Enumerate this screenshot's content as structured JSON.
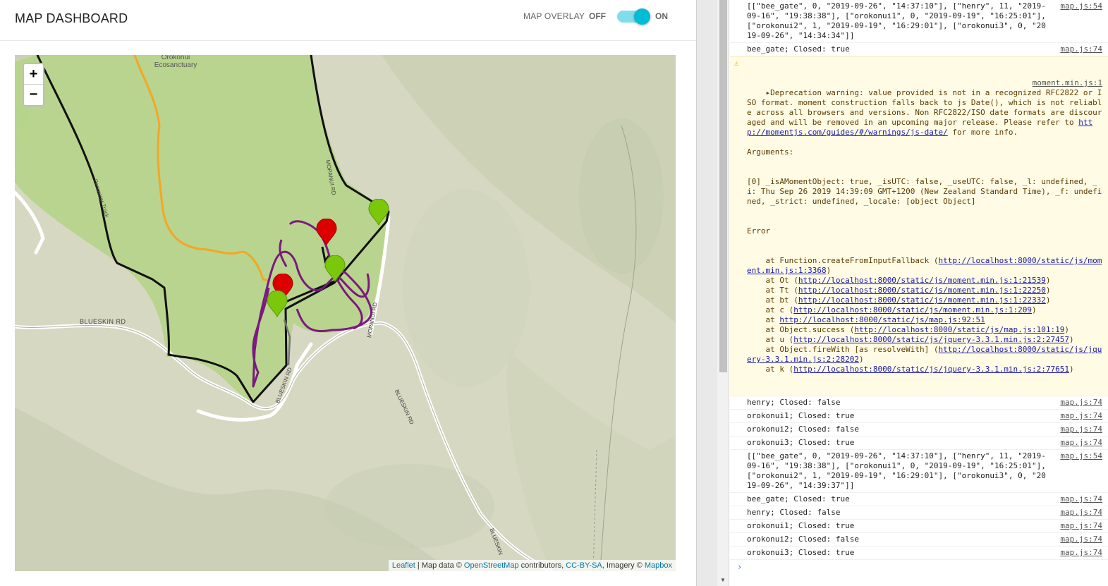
{
  "header": {
    "title": "MAP DASHBOARD",
    "overlay_label": "MAP OVERLAY",
    "off_label": "OFF",
    "on_label": "ON",
    "overlay_enabled": true
  },
  "map": {
    "zoom_in": "+",
    "zoom_out": "−",
    "labels": {
      "ecosanctuary": "Orokonui Ecosanctuary",
      "blueskin_rd": "BLUESKIN RD",
      "mopanui_rd": "MOPANUI RD",
      "perimeter_track": "Perimeter Track",
      "blueskin_short": "BLUESKIN"
    },
    "attribution": {
      "leaflet": "Leaflet",
      "map_data": " | Map data © ",
      "osm": "OpenStreetMap",
      "contributors": " contributors, ",
      "ccbysa": "CC-BY-SA",
      "imagery": ", Imagery © ",
      "mapbox": "Mapbox"
    },
    "colors": {
      "sanctuary_fill": "#b5d48a",
      "boundary": "#111111",
      "trail_orange": "#f5a623",
      "trail_purple": "#7b1a7e",
      "marker_open": "#7ac70c",
      "marker_closed": "#dd0000"
    },
    "markers": [
      {
        "name": "green-marker-1",
        "status": "open"
      },
      {
        "name": "red-marker-1",
        "status": "closed"
      },
      {
        "name": "green-marker-2",
        "status": "open"
      },
      {
        "name": "red-marker-2",
        "status": "closed"
      },
      {
        "name": "green-marker-3",
        "status": "open"
      }
    ]
  },
  "console": {
    "lines": [
      {
        "text": "[[\"bee_gate\", 0, \"2019-09-26\", \"14:37:10\"], [\"henry\", 11, \"2019-09-16\", \"19:38:38\"], [\"orokonui1\", 0, \"2019-09-19\", \"16:25:01\"], [\"orokonui2\", 1, \"2019-09-19\", \"16:29:01\"], [\"orokonui3\", 0, \"2019-09-26\", \"14:34:34\"]]",
        "src": "map.js:54"
      },
      {
        "text": "bee_gate; Closed: true",
        "src": "map.js:74"
      }
    ],
    "warning": {
      "src": "moment.min.js:1",
      "intro": "Deprecation warning: value provided is not in a recognized RFC2822 or ISO format. moment construction falls back to js Date(), which is not reliable across all browsers and versions. Non RFC2822/ISO date formats are discouraged and will be removed in an upcoming major release. Please refer to ",
      "link": "http://momentjs.com/guides/#/warnings/js-date/",
      "outro": " for more info.",
      "args_header": "Arguments:",
      "args": "[0] _isAMomentObject: true, _isUTC: false, _useUTC: false, _l: undefined, _i: Thu Sep 26 2019 14:39:09 GMT+1200 (New Zealand Standard Time), _f: undefined, _strict: undefined, _locale: [object Object]",
      "error": "Error",
      "stack": [
        {
          "prefix": "    at Function.createFromInputFallback (",
          "url": "http://localhost:8000/static/js/moment.min.js:1:3368",
          "suffix": ")"
        },
        {
          "prefix": "    at Ot (",
          "url": "http://localhost:8000/static/js/moment.min.js:1:21539",
          "suffix": ")"
        },
        {
          "prefix": "    at Tt (",
          "url": "http://localhost:8000/static/js/moment.min.js:1:22250",
          "suffix": ")"
        },
        {
          "prefix": "    at bt (",
          "url": "http://localhost:8000/static/js/moment.min.js:1:22332",
          "suffix": ")"
        },
        {
          "prefix": "    at c (",
          "url": "http://localhost:8000/static/js/moment.min.js:1:209",
          "suffix": ")"
        },
        {
          "prefix": "    at ",
          "url": "http://localhost:8000/static/js/map.js:92:51",
          "suffix": ""
        },
        {
          "prefix": "    at Object.success (",
          "url": "http://localhost:8000/static/js/map.js:101:19",
          "suffix": ")"
        },
        {
          "prefix": "    at u (",
          "url": "http://localhost:8000/static/js/jquery-3.3.1.min.js:2:27457",
          "suffix": ")"
        },
        {
          "prefix": "    at Object.fireWith [as resolveWith] (",
          "url": "http://localhost:8000/static/js/jquery-3.3.1.min.js:2:28202",
          "suffix": ")"
        },
        {
          "prefix": "    at k (",
          "url": "http://localhost:8000/static/js/jquery-3.3.1.min.js:2:77651",
          "suffix": ")"
        }
      ]
    },
    "lines_after": [
      {
        "text": "henry; Closed: false",
        "src": "map.js:74"
      },
      {
        "text": "orokonui1; Closed: true",
        "src": "map.js:74"
      },
      {
        "text": "orokonui2; Closed: false",
        "src": "map.js:74"
      },
      {
        "text": "orokonui3; Closed: true",
        "src": "map.js:74"
      },
      {
        "text": "[[\"bee_gate\", 0, \"2019-09-26\", \"14:37:10\"], [\"henry\", 11, \"2019-09-16\", \"19:38:38\"], [\"orokonui1\", 0, \"2019-09-19\", \"16:25:01\"], [\"orokonui2\", 1, \"2019-09-19\", \"16:29:01\"], [\"orokonui3\", 0, \"2019-09-26\", \"14:39:37\"]]",
        "src": "map.js:54"
      },
      {
        "text": "bee_gate; Closed: true",
        "src": "map.js:74"
      },
      {
        "text": "henry; Closed: false",
        "src": "map.js:74"
      },
      {
        "text": "orokonui1; Closed: true",
        "src": "map.js:74"
      },
      {
        "text": "orokonui2; Closed: false",
        "src": "map.js:74"
      },
      {
        "text": "orokonui3; Closed: true",
        "src": "map.js:74"
      }
    ],
    "prompt": "›"
  }
}
